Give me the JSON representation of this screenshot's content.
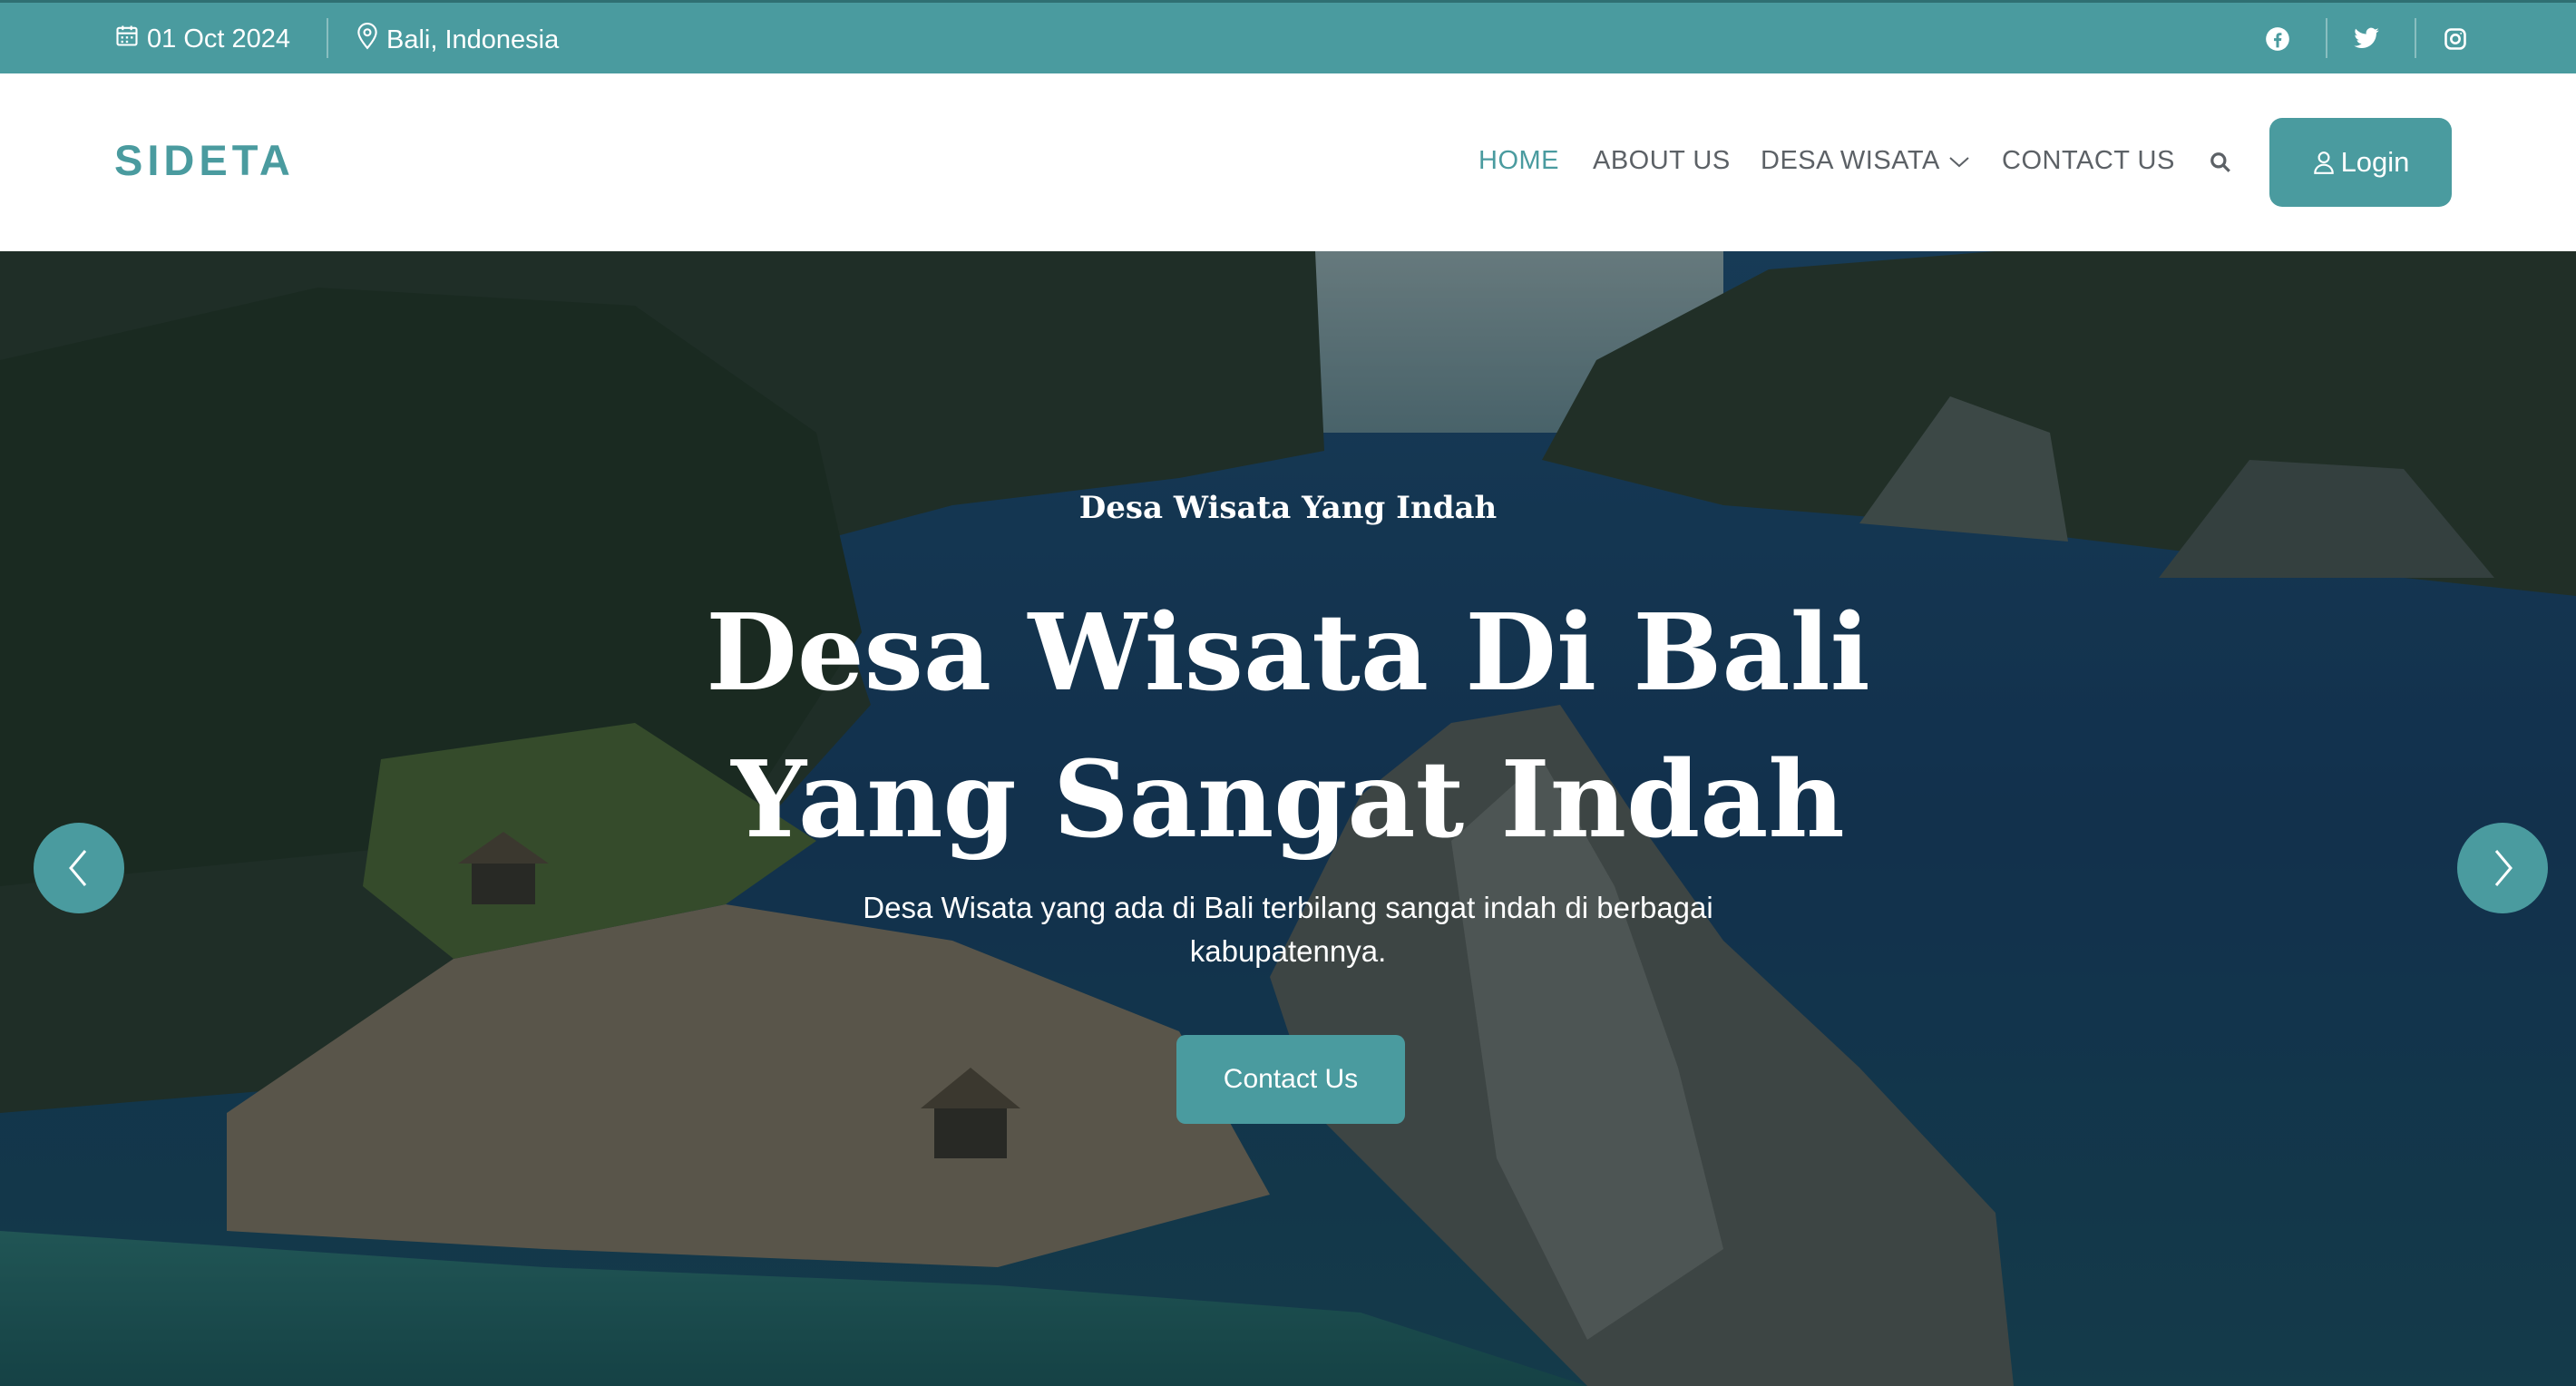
{
  "topbar": {
    "date": "01 Oct 2024",
    "location": "Bali, Indonesia",
    "social": [
      "facebook-icon",
      "twitter-icon",
      "instagram-icon"
    ]
  },
  "navbar": {
    "brand": "SIDETA",
    "links": [
      {
        "label": "HOME",
        "active": true
      },
      {
        "label": "ABOUT US",
        "active": false
      },
      {
        "label": "DESA WISATA",
        "active": false,
        "dropdown": true
      },
      {
        "label": "CONTACT US",
        "active": false
      }
    ],
    "login_label": "Login"
  },
  "hero": {
    "subtitle": "Desa Wisata Yang Indah",
    "title_line1": "Desa Wisata Di Bali",
    "title_line2": "Yang Sangat Indah",
    "description": "Desa Wisata yang ada di Bali terbilang sangat indah di berbagai kabupatennya.",
    "cta_label": "Contact Us"
  },
  "colors": {
    "accent": "#4a9b9f",
    "nav_text": "#5c6166",
    "white": "#ffffff"
  }
}
